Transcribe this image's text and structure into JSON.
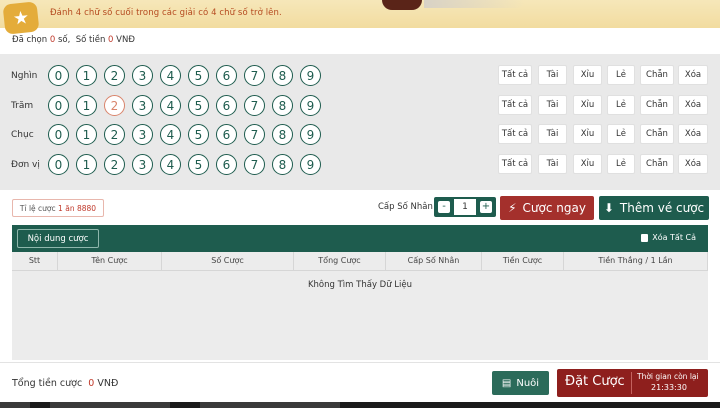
{
  "hint": {
    "text": "Đánh 4 chữ số cuối trong các giải có 4 chữ số trở lên.",
    "star_icon": "star-icon"
  },
  "selection": {
    "chosen_prefix": "Đã chọn ",
    "chosen_count": "0",
    "chosen_suffix": " số,",
    "money_prefix": "Số tiền ",
    "money_value": "0",
    "money_suffix": " VNĐ"
  },
  "board": {
    "rows": [
      {
        "label": "Nghìn",
        "selected": []
      },
      {
        "label": "Trăm",
        "selected": [
          "2"
        ]
      },
      {
        "label": "Chục",
        "selected": []
      },
      {
        "label": "Đơn vị",
        "selected": []
      }
    ],
    "digits": [
      "0",
      "1",
      "2",
      "3",
      "4",
      "5",
      "6",
      "7",
      "8",
      "9"
    ],
    "quick_buttons": [
      "Tất cả",
      "Tài",
      "Xỉu",
      "Lẻ",
      "Chẵn",
      "Xóa"
    ]
  },
  "ratio": {
    "prefix": "Tỉ lệ cược ",
    "a": "1",
    "mid": " ăn ",
    "b": "8880"
  },
  "multiplier": {
    "label": "Cấp Số Nhân",
    "value": "1",
    "minus": "-",
    "plus": "+"
  },
  "actions": {
    "bet_now": "Cược ngay",
    "add_bet": "Thêm vé cược"
  },
  "table": {
    "tab_label": "Nội dung cược",
    "clear_all": "Xóa Tất Cả",
    "columns": [
      "Stt",
      "Tên Cược",
      "Số Cược",
      "Tổng Cược",
      "Cấp Số Nhân",
      "Tiền Cược",
      "Tiền Thắng / 1 Lần"
    ],
    "empty_text": "Không Tìm Thấy Dữ Liệu"
  },
  "footer": {
    "total_label": "Tổng tiền cược",
    "total_value": "0",
    "total_unit": "VNĐ",
    "nuoi_label": "Nuôi",
    "place_bet": "Đặt Cược",
    "time_left_label": "Thời gian còn lại",
    "time_left": "21:33:30"
  },
  "colors": {
    "primary_green": "#1e5c4e",
    "bet_red": "#a4302c",
    "place_bet_red": "#8e1f1d",
    "hint_bg": "#f2dca0",
    "highlight_red": "#c0392b"
  }
}
